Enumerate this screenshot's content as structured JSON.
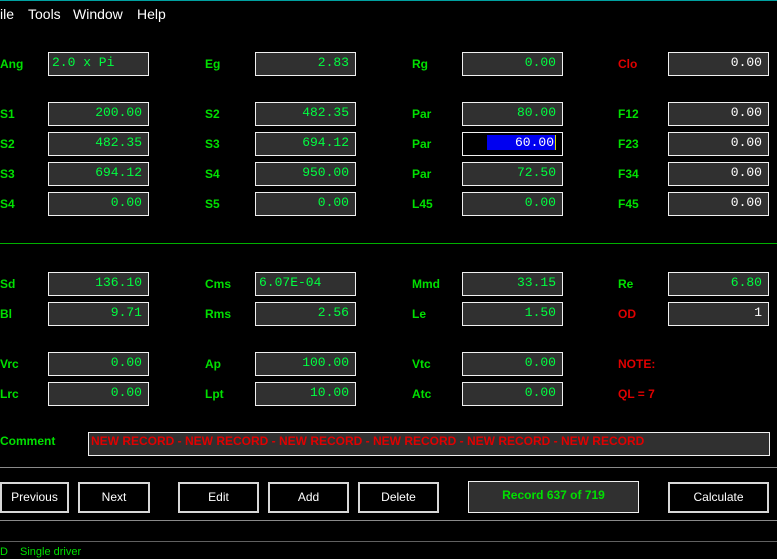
{
  "menu": [
    "ile",
    "Tools",
    "Window",
    "Help"
  ],
  "top_fields": [
    [
      {
        "label": "Ang",
        "value": "2.0 x Pi",
        "labelColor": "green",
        "align": "left"
      },
      {
        "label": "Eg",
        "value": "2.83"
      },
      {
        "label": "Rg",
        "value": "0.00"
      },
      {
        "label": "Clo",
        "value": "0.00",
        "labelColor": "red",
        "valueColor": "white"
      }
    ],
    [
      {
        "label": "S1",
        "value": "200.00"
      },
      {
        "label": "S2",
        "value": "482.35"
      },
      {
        "label": "Par",
        "value": "80.00"
      },
      {
        "label": "F12",
        "value": "0.00",
        "valueColor": "white"
      }
    ],
    [
      {
        "label": "S2",
        "value": "482.35"
      },
      {
        "label": "S3",
        "value": "694.12"
      },
      {
        "label": "Par",
        "value": "60.00",
        "selected": true
      },
      {
        "label": "F23",
        "value": "0.00",
        "valueColor": "white"
      }
    ],
    [
      {
        "label": "S3",
        "value": "694.12"
      },
      {
        "label": "S4",
        "value": "950.00"
      },
      {
        "label": "Par",
        "value": "72.50"
      },
      {
        "label": "F34",
        "value": "0.00",
        "valueColor": "white"
      }
    ],
    [
      {
        "label": "S4",
        "value": "0.00"
      },
      {
        "label": "S5",
        "value": "0.00"
      },
      {
        "label": "L45",
        "value": "0.00"
      },
      {
        "label": "F45",
        "value": "0.00",
        "valueColor": "white"
      }
    ]
  ],
  "bottom_fields": [
    [
      {
        "label": "Sd",
        "value": "136.10"
      },
      {
        "label": "Cms",
        "value": "6.07E-04",
        "align": "left"
      },
      {
        "label": "Mmd",
        "value": "33.15"
      },
      {
        "label": "Re",
        "value": "6.80"
      }
    ],
    [
      {
        "label": "Bl",
        "value": "9.71"
      },
      {
        "label": "Rms",
        "value": "2.56"
      },
      {
        "label": "Le",
        "value": "1.50"
      },
      {
        "label": "OD",
        "value": "1",
        "labelColor": "red",
        "valueColor": "white"
      }
    ],
    [
      {
        "label": "Vrc",
        "value": "0.00"
      },
      {
        "label": "Ap",
        "value": "100.00"
      },
      {
        "label": "Vtc",
        "value": "0.00"
      },
      {
        "label": "NOTE:",
        "labelColor": "red",
        "noField": true
      }
    ],
    [
      {
        "label": "Lrc",
        "value": "0.00"
      },
      {
        "label": "Lpt",
        "value": "10.00"
      },
      {
        "label": "Atc",
        "value": "0.00"
      },
      {
        "label": "QL = 7",
        "labelColor": "red",
        "noField": true
      }
    ]
  ],
  "comment": {
    "label": "Comment",
    "value": "NEW RECORD - NEW RECORD - NEW RECORD - NEW RECORD - NEW RECORD - NEW RECORD"
  },
  "buttons": {
    "previous": "Previous",
    "next": "Next",
    "edit": "Edit",
    "add": "Add",
    "delete": "Delete",
    "calculate": "Calculate"
  },
  "record_status": "Record 637 of 719",
  "status_bar": {
    "left": "D",
    "right": "Single driver"
  }
}
